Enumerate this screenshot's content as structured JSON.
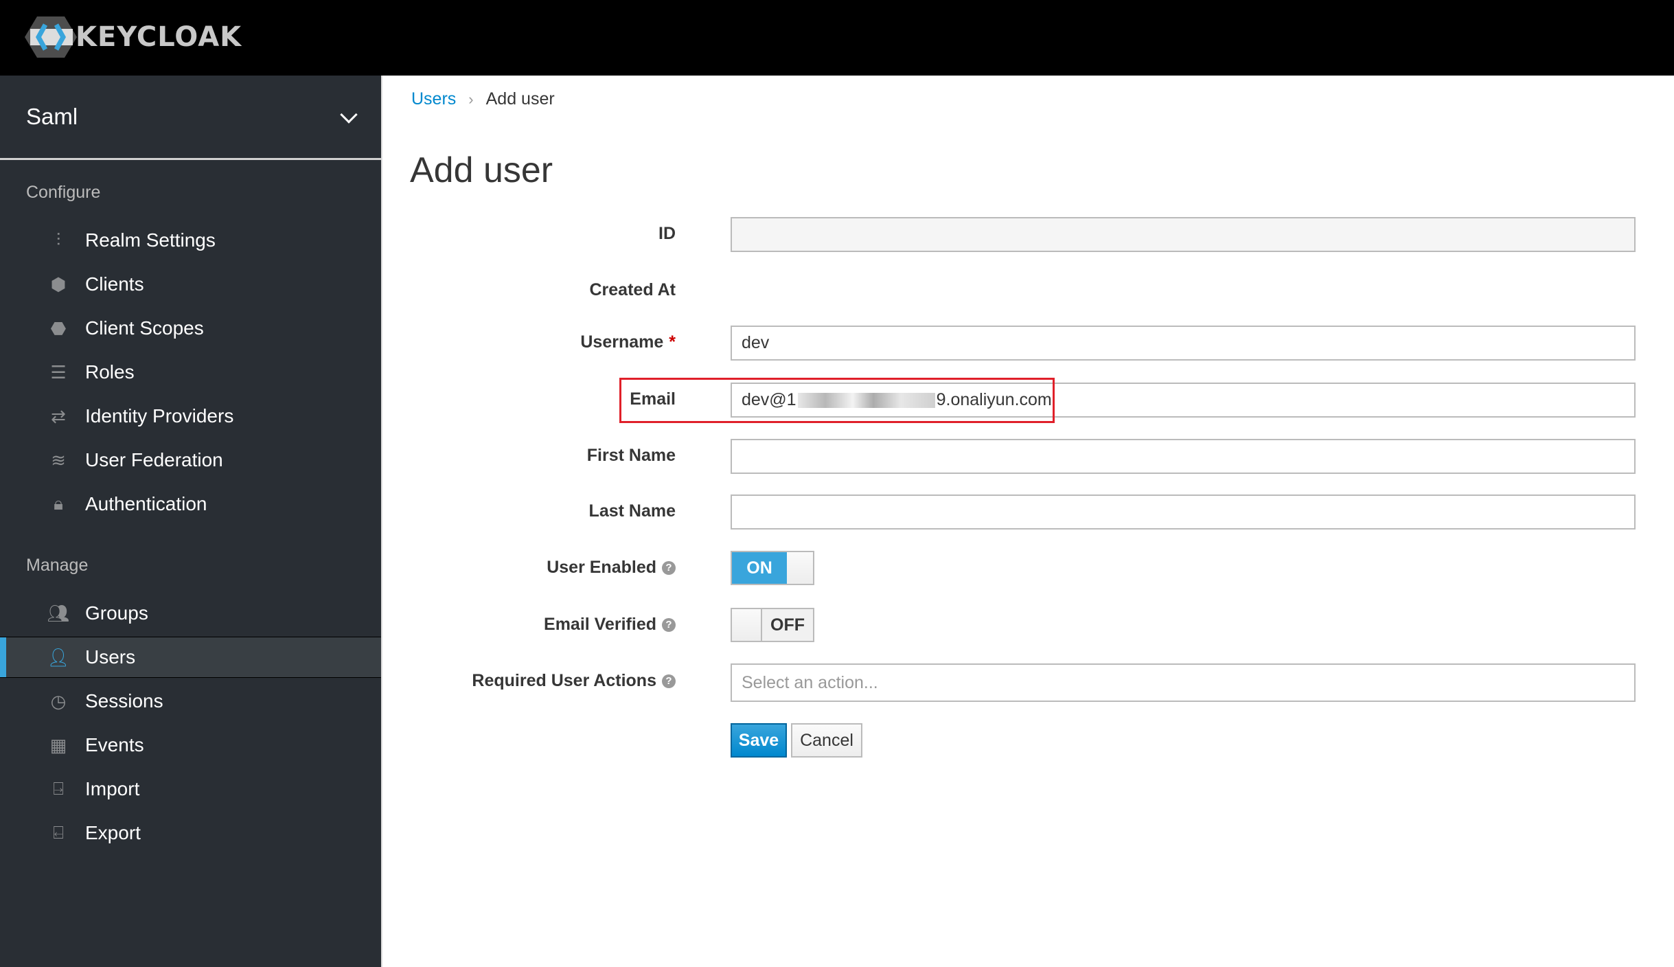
{
  "header": {
    "logo_text": "KEYCLOAK"
  },
  "sidebar": {
    "realm": "Saml",
    "configure_label": "Configure",
    "configure_items": [
      {
        "label": "Realm Settings",
        "icon": "sliders-icon"
      },
      {
        "label": "Clients",
        "icon": "cube-icon"
      },
      {
        "label": "Client Scopes",
        "icon": "cubes-icon"
      },
      {
        "label": "Roles",
        "icon": "list-icon"
      },
      {
        "label": "Identity Providers",
        "icon": "exchange-icon"
      },
      {
        "label": "User Federation",
        "icon": "database-icon"
      },
      {
        "label": "Authentication",
        "icon": "lock-icon"
      }
    ],
    "manage_label": "Manage",
    "manage_items": [
      {
        "label": "Groups",
        "icon": "users-icon"
      },
      {
        "label": "Users",
        "icon": "user-icon",
        "active": true
      },
      {
        "label": "Sessions",
        "icon": "clock-icon"
      },
      {
        "label": "Events",
        "icon": "calendar-icon"
      },
      {
        "label": "Import",
        "icon": "import-icon"
      },
      {
        "label": "Export",
        "icon": "export-icon"
      }
    ]
  },
  "breadcrumb": {
    "parent": "Users",
    "current": "Add user"
  },
  "form": {
    "title": "Add user",
    "id_label": "ID",
    "id_value": "",
    "created_label": "Created At",
    "username_label": "Username",
    "required_mark": "*",
    "username_value": "dev",
    "email_label": "Email",
    "email_prefix": "dev@1",
    "email_suffix": "9.onaliyun.com",
    "first_label": "First Name",
    "first_value": "",
    "last_label": "Last Name",
    "last_value": "",
    "enabled_label": "User Enabled",
    "enabled_state": "ON",
    "verified_label": "Email Verified",
    "verified_state": "OFF",
    "actions_label": "Required User Actions",
    "actions_placeholder": "Select an action...",
    "help_glyph": "?",
    "save": "Save",
    "cancel": "Cancel"
  },
  "colors": {
    "accent": "#39a5dc",
    "highlight": "#e0202a",
    "sidebar": "#292e34"
  }
}
